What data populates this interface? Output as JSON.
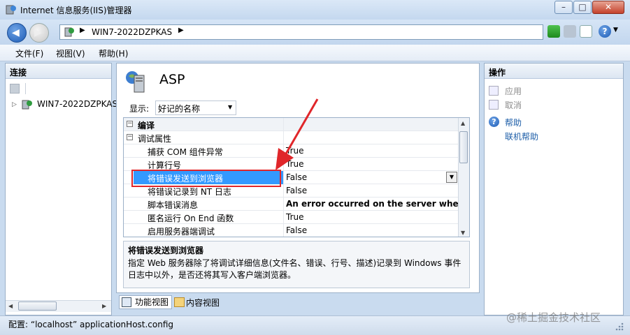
{
  "window": {
    "title": "Internet 信息服务(IIS)管理器"
  },
  "nav": {
    "address_segments": [
      "WIN7-2022DZPKAS"
    ],
    "icons": [
      "back-icon",
      "forward-icon",
      "refresh-icon",
      "stop-icon",
      "home-icon",
      "help-icon"
    ]
  },
  "menu": {
    "file": "文件(F)",
    "view": "视图(V)",
    "help": "帮助(H)"
  },
  "left": {
    "header": "连接",
    "tree_node": "WIN7-2022DZPKAS"
  },
  "center": {
    "feature_title": "ASP",
    "show_label": "显示:",
    "show_value": "好记的名称",
    "grid": {
      "rows": [
        {
          "name": "编译",
          "value": "",
          "group": true,
          "bold": true
        },
        {
          "name": "调试属性",
          "value": "",
          "group": true
        },
        {
          "name": "捕获 COM 组件异常",
          "value": "True"
        },
        {
          "name": "计算行号",
          "value": "True"
        },
        {
          "name": "将错误发送到浏览器",
          "value": "False",
          "selected": true
        },
        {
          "name": "将错误记录到 NT 日志",
          "value": "False"
        },
        {
          "name": "脚本错误消息",
          "value": "An error occurred on the server when pr",
          "bold_value": true
        },
        {
          "name": "匿名运行 On End 函数",
          "value": "True"
        },
        {
          "name": "启用服务器端调试",
          "value": "False"
        }
      ]
    },
    "description": {
      "title": "将错误发送到浏览器",
      "text": "指定 Web 服务器除了将调试详细信息(文件名、错误、行号、描述)记录到 Windows 事件日志中以外，是否还将其写入客户端浏览器。"
    },
    "tabs": {
      "features": "功能视图",
      "content": "内容视图"
    }
  },
  "right": {
    "header": "操作",
    "apply": "应用",
    "cancel": "取消",
    "help": "帮助",
    "online_help": "联机帮助"
  },
  "status": {
    "text": "配置: “localhost”  applicationHost.config"
  },
  "watermark": "@稀土掘金技术社区",
  "colors": {
    "selection": "#3399ff",
    "annotation": "#e0262a",
    "link": "#1d5ea8"
  }
}
